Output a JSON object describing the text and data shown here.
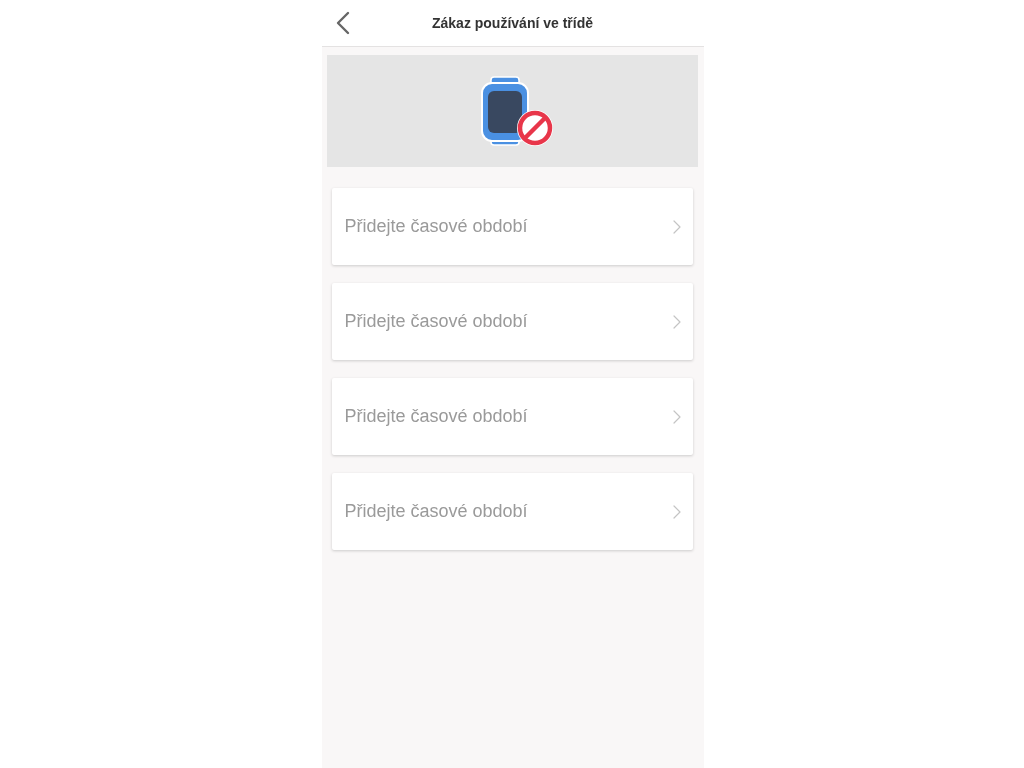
{
  "header": {
    "title": "Zákaz používání ve třídě"
  },
  "periods": [
    {
      "label": "Přidejte časové období"
    },
    {
      "label": "Přidejte časové období"
    },
    {
      "label": "Přidejte časové období"
    },
    {
      "label": "Přidejte časové období"
    }
  ]
}
